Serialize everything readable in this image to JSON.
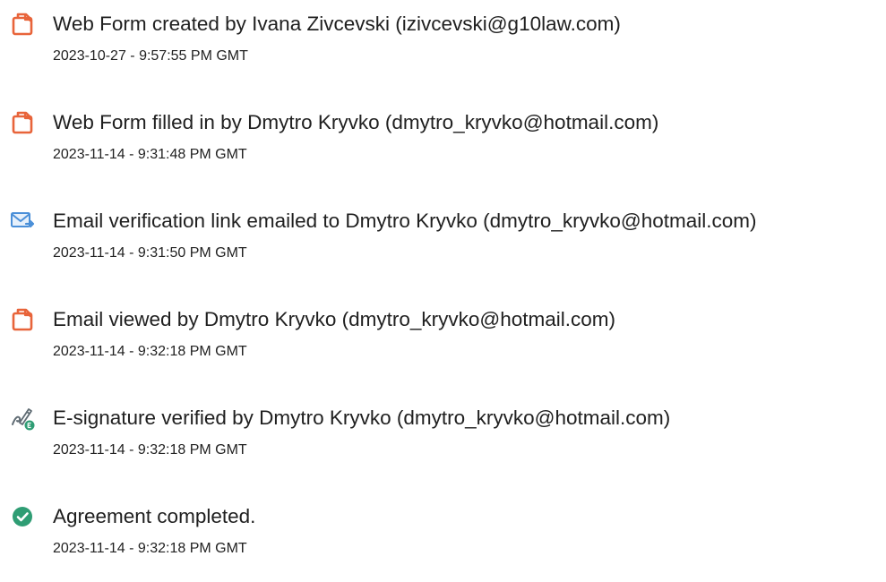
{
  "colors": {
    "document_icon": "#e8643a",
    "email_icon": "#4a8fd8",
    "signature_icon": "#5f6b73",
    "signature_badge": "#2f9d74",
    "check_icon": "#2f9d74"
  },
  "events": [
    {
      "icon": "document-icon",
      "text": "Web Form created by Ivana Zivcevski (izivcevski@g10law.com)",
      "time": "2023-10-27 - 9:57:55 PM GMT"
    },
    {
      "icon": "document-icon",
      "text": "Web Form filled in by Dmytro Kryvko (dmytro_kryvko@hotmail.com)",
      "time": "2023-11-14 - 9:31:48 PM GMT"
    },
    {
      "icon": "email-send-icon",
      "text": "Email verification link emailed to Dmytro Kryvko (dmytro_kryvko@hotmail.com)",
      "time": "2023-11-14 - 9:31:50 PM GMT"
    },
    {
      "icon": "document-icon",
      "text": "Email viewed by Dmytro Kryvko (dmytro_kryvko@hotmail.com)",
      "time": "2023-11-14 - 9:32:18 PM GMT"
    },
    {
      "icon": "e-signature-icon",
      "text": "E-signature verified by Dmytro Kryvko (dmytro_kryvko@hotmail.com)",
      "time": "2023-11-14 - 9:32:18 PM GMT"
    },
    {
      "icon": "check-circle-icon",
      "text": "Agreement completed.",
      "time": "2023-11-14 - 9:32:18 PM GMT"
    }
  ]
}
